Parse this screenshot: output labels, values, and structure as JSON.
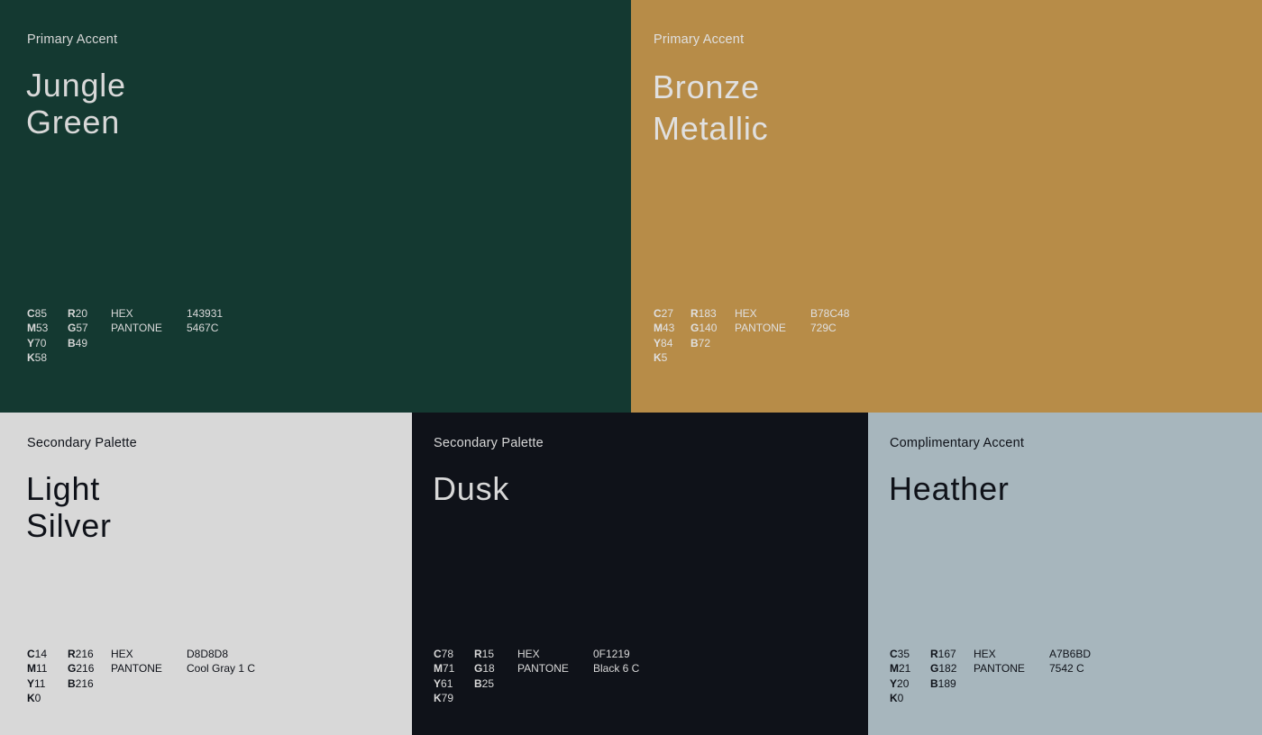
{
  "swatches": {
    "jungle": {
      "kicker": "Primary Accent",
      "name_line1": "Jungle",
      "name_line2": "Green",
      "bg": "#143931",
      "fg": "#d8d8d8",
      "cmyk": [
        [
          "C",
          "85"
        ],
        [
          "M",
          "53"
        ],
        [
          "Y",
          "70"
        ],
        [
          "K",
          "58"
        ]
      ],
      "rgb": [
        [
          "R",
          "20"
        ],
        [
          "G",
          "57"
        ],
        [
          "B",
          "49"
        ]
      ],
      "hex_label": "HEX",
      "hex": "143931",
      "pantone_label": "PANTONE",
      "pantone": "5467C"
    },
    "bronze": {
      "kicker": "Primary Accent",
      "name_line1": "Bronze",
      "name_line2": "Metallic",
      "bg": "#B78C48",
      "fg": "#e0e0e0",
      "cmyk": [
        [
          "C",
          "27"
        ],
        [
          "M",
          "43"
        ],
        [
          "Y",
          "84"
        ],
        [
          "K",
          "5"
        ]
      ],
      "rgb": [
        [
          "R",
          "183"
        ],
        [
          "G",
          "140"
        ],
        [
          "B",
          "72"
        ]
      ],
      "hex_label": "HEX",
      "hex": "B78C48",
      "pantone_label": "PANTONE",
      "pantone": "729C"
    },
    "silver": {
      "kicker": "Secondary Palette",
      "name_line1": "Light",
      "name_line2": "Silver",
      "bg": "#D8D8D8",
      "fg": "#0f1219",
      "cmyk": [
        [
          "C",
          "14"
        ],
        [
          "M",
          "11"
        ],
        [
          "Y",
          "11"
        ],
        [
          "K",
          "0"
        ]
      ],
      "rgb": [
        [
          "R",
          "216"
        ],
        [
          "G",
          "216"
        ],
        [
          "B",
          "216"
        ]
      ],
      "hex_label": "HEX",
      "hex": "D8D8D8",
      "pantone_label": "PANTONE",
      "pantone": "Cool Gray 1 C"
    },
    "dusk": {
      "kicker": "Secondary Palette",
      "name_line1": "Dusk",
      "name_line2": "",
      "bg": "#0F1219",
      "fg": "#d8d8d8",
      "cmyk": [
        [
          "C",
          "78"
        ],
        [
          "M",
          "71"
        ],
        [
          "Y",
          "61"
        ],
        [
          "K",
          "79"
        ]
      ],
      "rgb": [
        [
          "R",
          "15"
        ],
        [
          "G",
          "18"
        ],
        [
          "B",
          "25"
        ]
      ],
      "hex_label": "HEX",
      "hex": "0F1219",
      "pantone_label": "PANTONE",
      "pantone": "Black 6 C"
    },
    "heather": {
      "kicker": "Complimentary Accent",
      "name_line1": "Heather",
      "name_line2": "",
      "bg": "#A7B6BD",
      "fg": "#0f1219",
      "cmyk": [
        [
          "C",
          "35"
        ],
        [
          "M",
          "21"
        ],
        [
          "Y",
          "20"
        ],
        [
          "K",
          "0"
        ]
      ],
      "rgb": [
        [
          "R",
          "167"
        ],
        [
          "G",
          "182"
        ],
        [
          "B",
          "189"
        ]
      ],
      "hex_label": "HEX",
      "hex": "A7B6BD",
      "pantone_label": "PANTONE",
      "pantone": "7542 C"
    }
  }
}
